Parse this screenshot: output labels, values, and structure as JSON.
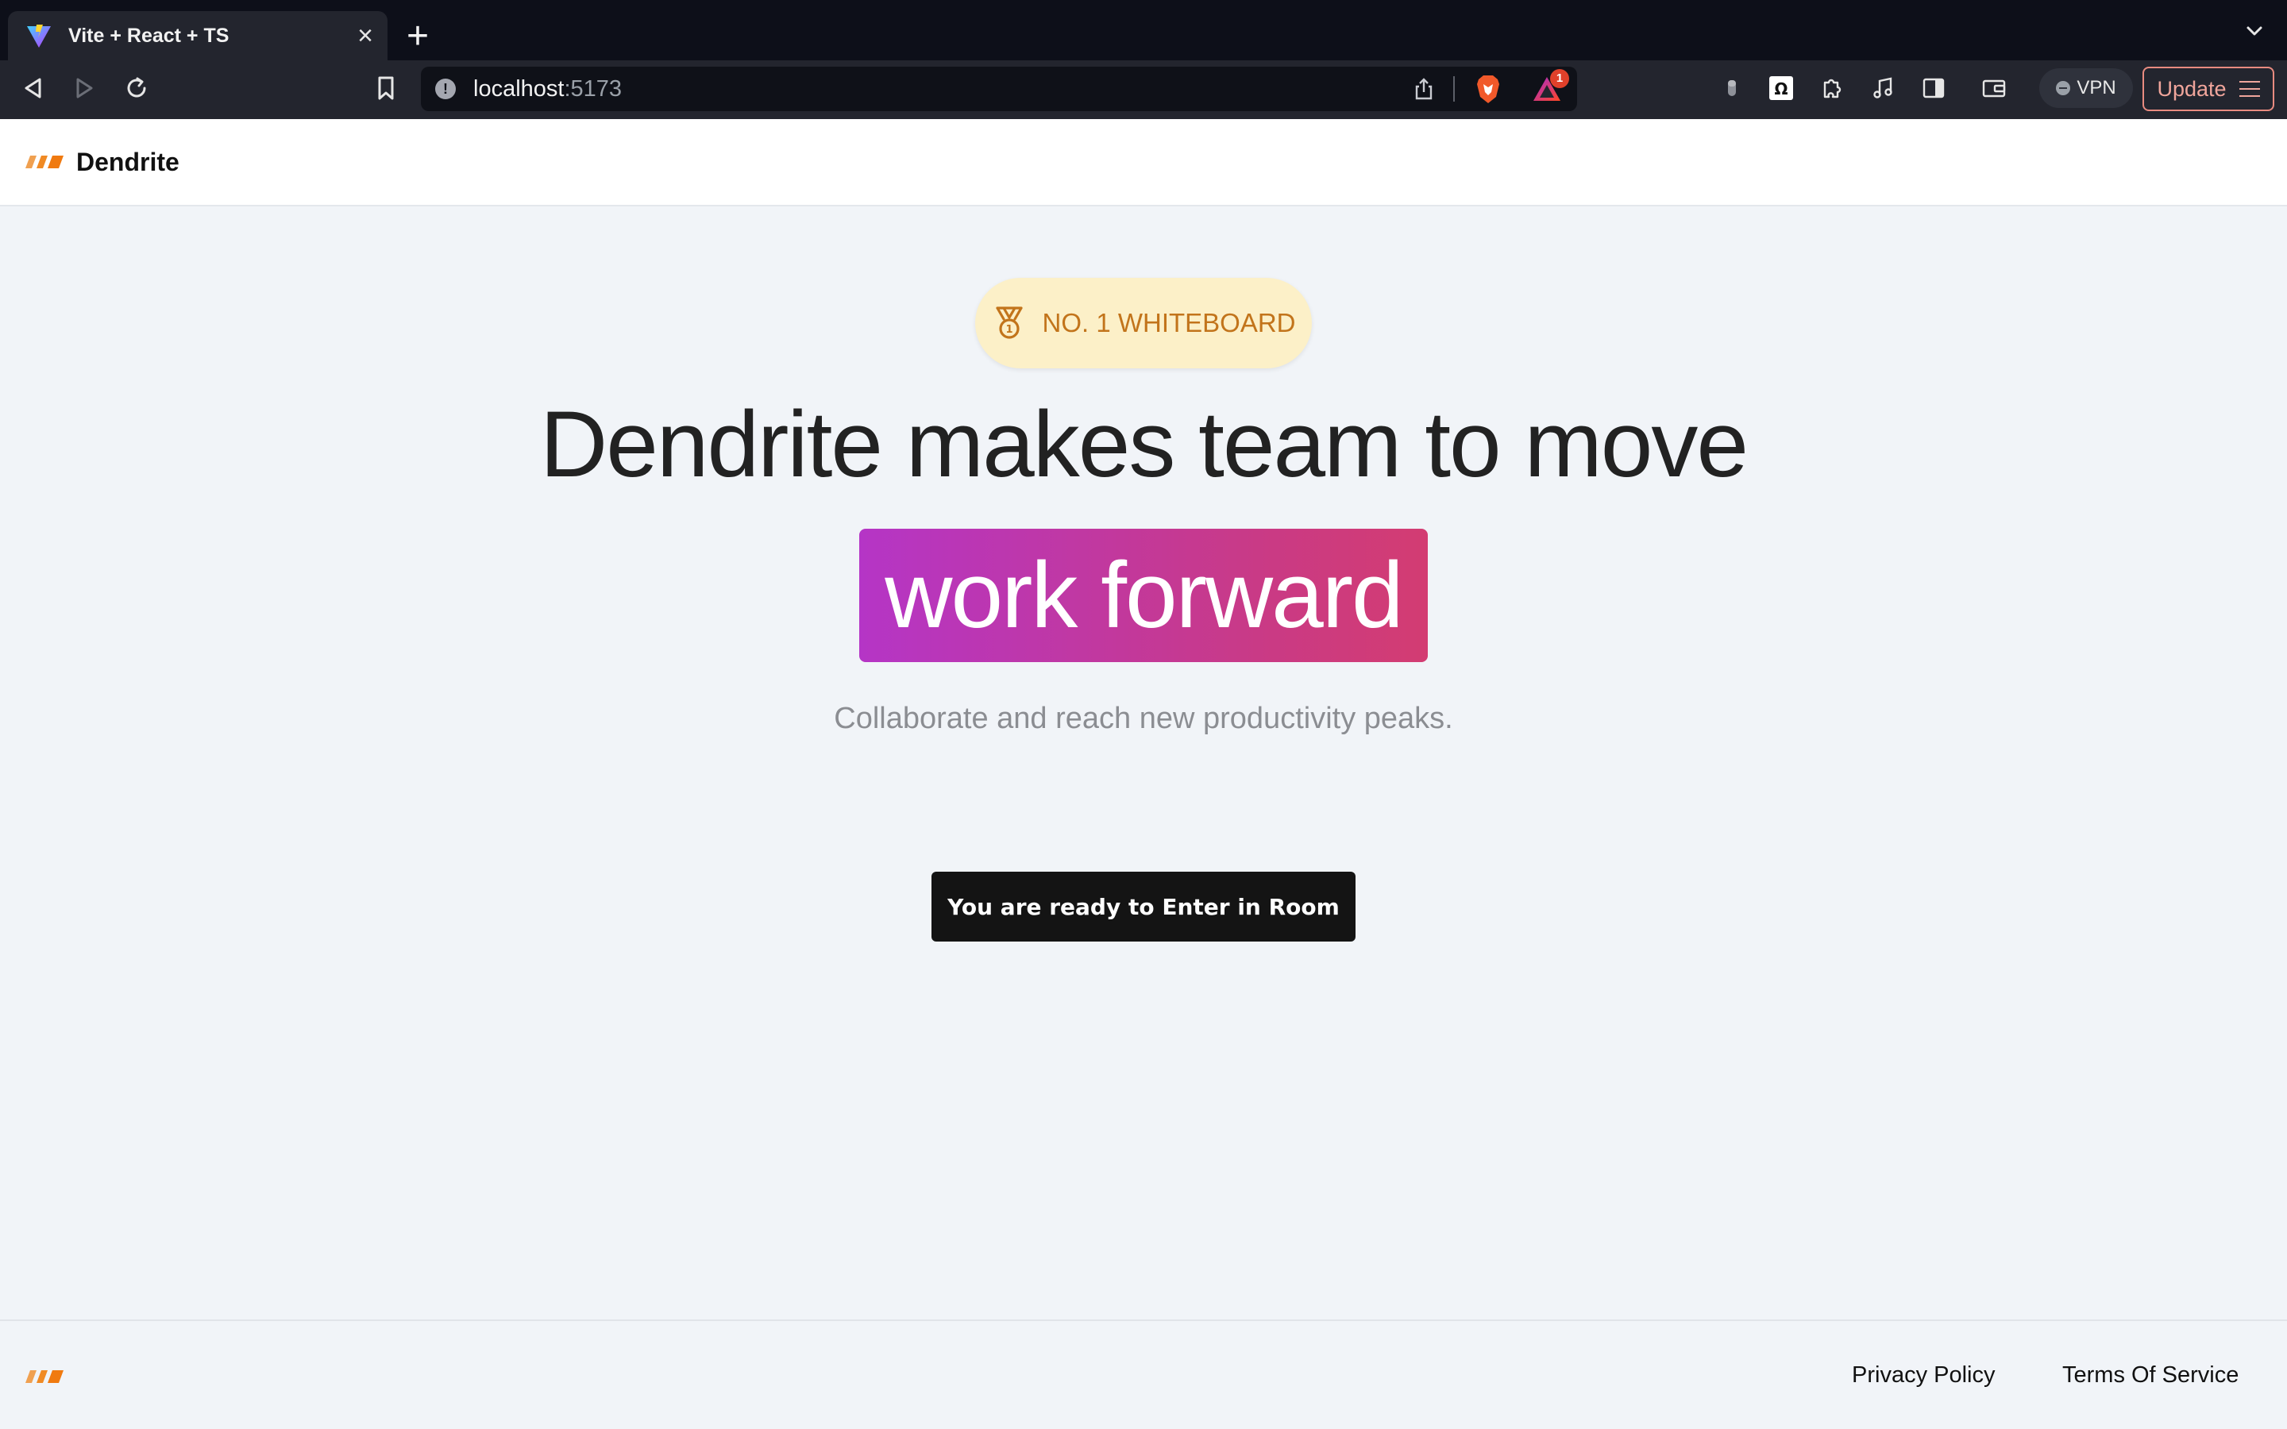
{
  "browser": {
    "tab_title": "Vite + React + TS",
    "url_host": "localhost",
    "url_port": ":5173",
    "rewards_badge_count": "1",
    "vpn_label": "VPN",
    "update_label": "Update"
  },
  "header": {
    "brand": "Dendrite"
  },
  "hero": {
    "badge_text": "NO. 1 WHITEBOARD",
    "headline": "Dendrite makes team to move",
    "highlight": "work forward",
    "subtitle": "Collaborate and reach new productivity peaks.",
    "cta_label": "You are ready to Enter in Room"
  },
  "footer": {
    "privacy_label": "Privacy Policy",
    "terms_label": "Terms Of Service"
  },
  "colors": {
    "logo_accent": "#f08a24",
    "badge_text": "#c2741b",
    "badge_bg": "#fcf0c8",
    "highlight_gradient_start": "#b535c6",
    "highlight_gradient_end": "#d33c72",
    "cta_bg": "#141414"
  },
  "icons": {
    "tab_favicon": "vite-logo-icon",
    "badge_icon": "medal-icon",
    "logo": "striped-slashes-logo"
  }
}
